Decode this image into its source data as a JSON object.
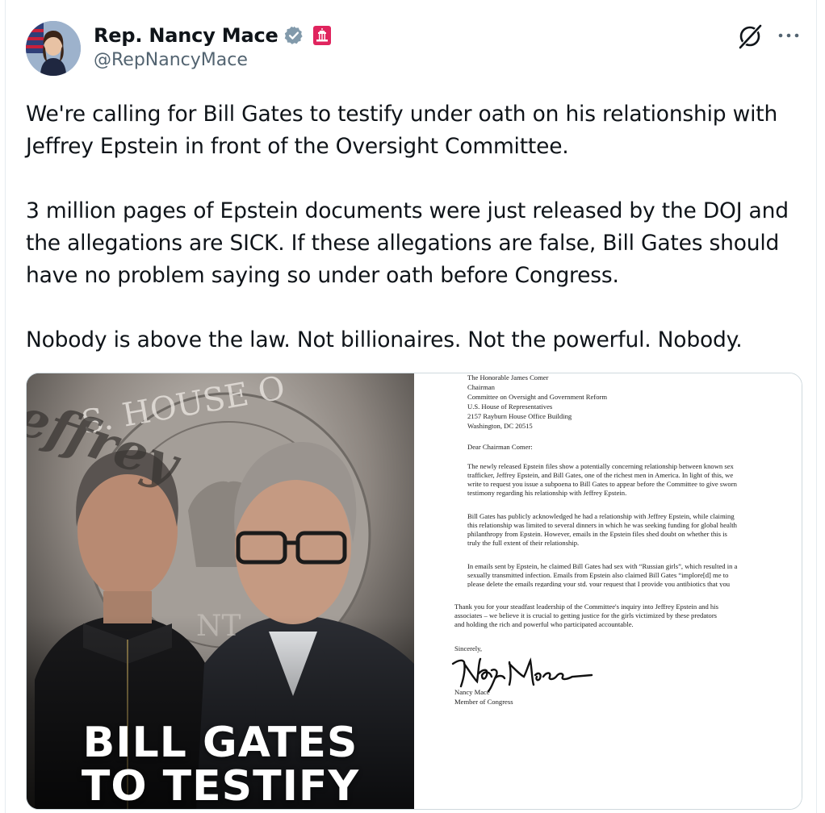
{
  "author": {
    "display_name": "Rep. Nancy Mace",
    "handle": "@RepNancyMace",
    "verified_icon": "verified-badge-icon",
    "affiliation_icon": "us-capitol-icon",
    "colors": {
      "verified": "#829aab",
      "affiliation": "#e0245e"
    }
  },
  "actions": {
    "grok_icon": "grok-icon",
    "more_icon": "more-dots-icon"
  },
  "tweet": {
    "paragraphs": [
      "We're calling for Bill Gates to testify under oath on his relationship with Jeffrey Epstein in front of the Oversight Committee.",
      "3 million pages of Epstein documents were just released by the DOJ and the allegations are SICK. If these allegations are false, Bill Gates should have no problem saying so under oath before Congress.",
      "Nobody is above the law. Not billionaires. Not the powerful. Nobody."
    ]
  },
  "media": {
    "photo": {
      "headline_line1": "BILL GATES",
      "headline_line2": "TO TESTIFY",
      "seal_text": "S. HOUSE O",
      "seal_bottom_text": "NT",
      "background_word": "effrey"
    },
    "letter": {
      "address": [
        "The Honorable James Comer",
        "Chairman",
        "Committee on Oversight and Government Reform",
        "U.S. House of Representatives",
        "2157 Rayburn House Office Building",
        "Washington, DC 20515"
      ],
      "salutation": "Dear Chairman Comer:",
      "para1": [
        "The newly released Epstein files show a potentially concerning relationship between known sex",
        "trafficker, Jeffrey Epstein, and Bill Gates, one of the richest men in America. In light of this, we",
        "write to request you issue a subpoena to Bill Gates to appear before the Committee to give sworn",
        "testimony regarding his relationship with Jeffrey Epstein."
      ],
      "para2": [
        "Bill Gates has publicly acknowledged he had a relationship with Jeffrey Epstein, while claiming",
        "this relationship was limited to several dinners in which he was seeking funding for global health",
        "philanthropy from Epstein. However, emails in the Epstein files shed doubt on whether this is",
        "truly the full extent of their relationship."
      ],
      "para3": [
        "In emails sent by Epstein, he claimed Bill Gates had sex with “Russian girls”, which resulted in a",
        "sexually transmitted infection. Emails from Epstein also claimed Bill Gates “implore[d] me to",
        "please delete the emails regarding your std. your request that I provide you antibiotics that you"
      ],
      "para4": [
        "Thank you for your steadfast leadership of the Committee's inquiry into Jeffrey Epstein and his",
        "associates – we believe it is crucial to getting justice for the girls victimized by these predators",
        "and holding the rich and powerful who participated accountable."
      ],
      "closing": "Sincerely,",
      "signature": "Nancy Mace",
      "signer_name": "Nancy Mace",
      "signer_title": "Member of Congress"
    }
  }
}
